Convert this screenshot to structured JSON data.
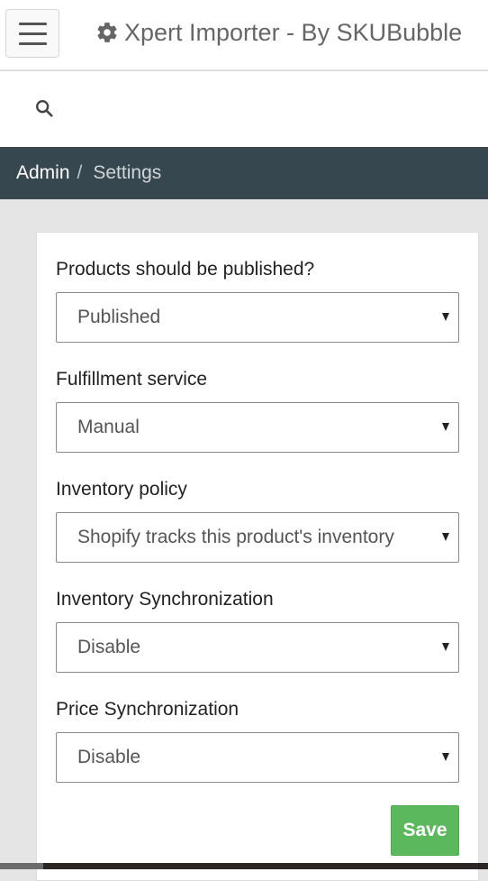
{
  "header": {
    "title": "Xpert Importer - By SKUBubble",
    "menu_icon": "hamburger-menu-icon",
    "logo_icon": "gear-icon"
  },
  "search": {
    "icon": "search-icon",
    "value": "",
    "placeholder": ""
  },
  "breadcrumb": {
    "items": [
      {
        "label": "Admin"
      },
      {
        "label": "Settings"
      }
    ],
    "separator": "/"
  },
  "form": {
    "fields": [
      {
        "label": "Products should be published?",
        "selected": "Published"
      },
      {
        "label": "Fulfillment service",
        "selected": "Manual"
      },
      {
        "label": "Inventory policy",
        "selected": "Shopify tracks this product's inventory"
      },
      {
        "label": "Inventory Synchronization",
        "selected": "Disable"
      },
      {
        "label": "Price Synchronization",
        "selected": "Disable"
      }
    ],
    "save_label": "Save"
  },
  "colors": {
    "breadcrumb_bg": "#37474f",
    "save_button": "#5cb85c",
    "page_bg": "#e5e5e5"
  }
}
